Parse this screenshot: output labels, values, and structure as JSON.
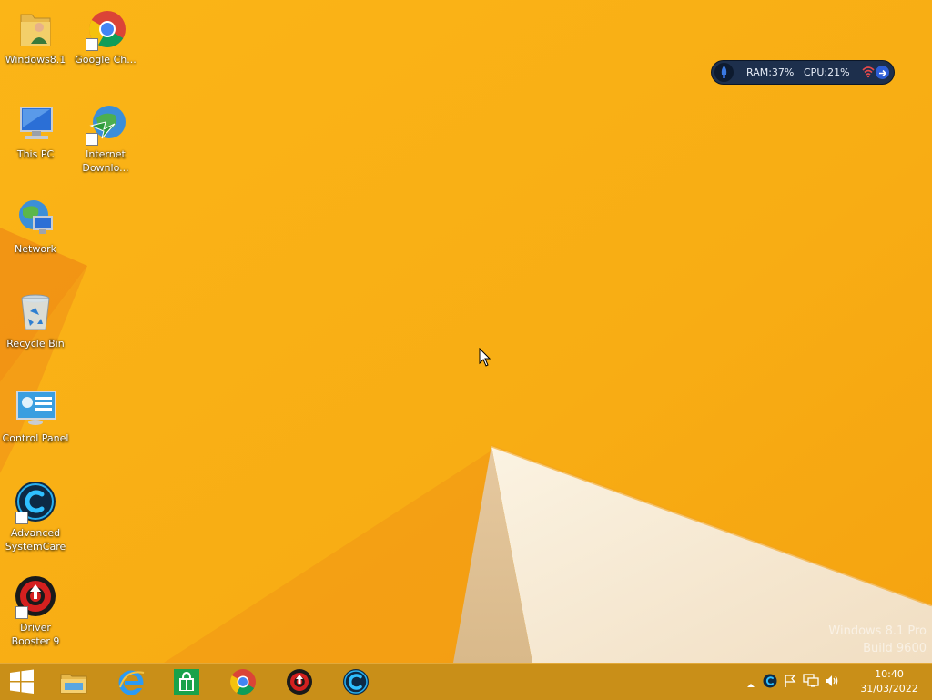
{
  "desktop": {
    "icons": [
      {
        "label": "Windows8.1",
        "icon": "user-folder-icon"
      },
      {
        "label": "Google Ch...",
        "icon": "chrome-icon"
      },
      {
        "label": "This PC",
        "icon": "computer-icon"
      },
      {
        "label": "Internet Downlo...",
        "icon": "idm-icon"
      },
      {
        "label": "Network",
        "icon": "network-globe-icon"
      },
      {
        "label": "Recycle Bin",
        "icon": "recycle-bin-icon"
      },
      {
        "label": "Control Panel",
        "icon": "control-panel-icon"
      },
      {
        "label": "Advanced SystemCare",
        "icon": "advanced-systemcare-icon"
      },
      {
        "label": "Driver Booster 9",
        "icon": "driver-booster-icon"
      }
    ]
  },
  "sysmon": {
    "ram": "RAM:37%",
    "cpu": "CPU:21%"
  },
  "watermark": {
    "line1": "Windows 8.1 Pro",
    "line2": "Build 9600"
  },
  "taskbar": {
    "pinned": [
      {
        "name": "start",
        "icon": "windows-logo-icon"
      },
      {
        "name": "file-explorer",
        "icon": "file-explorer-icon"
      },
      {
        "name": "internet-explorer",
        "icon": "internet-explorer-icon"
      },
      {
        "name": "store",
        "icon": "store-icon"
      },
      {
        "name": "chrome",
        "icon": "chrome-icon"
      },
      {
        "name": "driver-booster",
        "icon": "driver-booster-icon"
      },
      {
        "name": "advanced-systemcare",
        "icon": "advanced-systemcare-icon"
      }
    ],
    "tray": {
      "icons": [
        "show-hidden-icons-icon",
        "advanced-systemcare-icon",
        "action-center-flag-icon",
        "network-icon",
        "volume-icon"
      ],
      "time": "10:40",
      "date": "31/03/2022"
    }
  },
  "colors": {
    "wallpaper": "#f9b21a",
    "taskbar": "#c98f18",
    "widget": "#1d2f4c"
  }
}
